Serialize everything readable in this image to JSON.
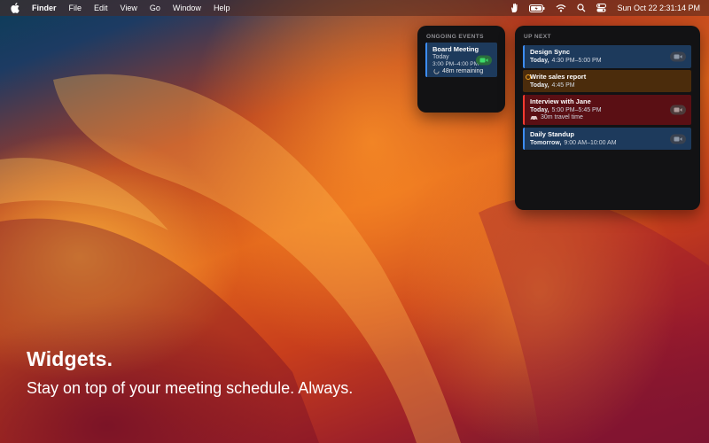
{
  "menubar": {
    "app_name": "Finder",
    "menus": [
      "File",
      "Edit",
      "View",
      "Go",
      "Window",
      "Help"
    ],
    "clock": "Sun Oct 22  2:31:14 PM",
    "icons": [
      "apple-icon",
      "hand-icon",
      "battery-icon",
      "wifi-icon",
      "search-icon",
      "control-center-icon"
    ]
  },
  "ongoing": {
    "header": "ONGOING EVENTS",
    "event": {
      "title": "Board Meeting",
      "day": "Today",
      "time": "3:00 PM–4:00 PM",
      "remaining": "48m remaining"
    }
  },
  "upnext": {
    "header": "UP NEXT",
    "events": [
      {
        "title": "Design Sync",
        "day": "Today,",
        "time": "4:30 PM–5:00 PM",
        "color": "#3d8df5"
      },
      {
        "title": "Write sales report",
        "day": "Today,",
        "time": "4:45 PM",
        "color": "#f5a623"
      },
      {
        "title": "Interview with Jane",
        "day": "Today,",
        "time": "5:00 PM–5:45 PM",
        "extra": "30m travel time",
        "color": "#ff3b30"
      },
      {
        "title": "Daily Standup",
        "day": "Tomorrow,",
        "time": "9:00 AM–10:00 AM",
        "color": "#3d8df5"
      }
    ]
  },
  "hero": {
    "title": "Widgets.",
    "subtitle": "Stay on top of your meeting schedule. Always."
  }
}
